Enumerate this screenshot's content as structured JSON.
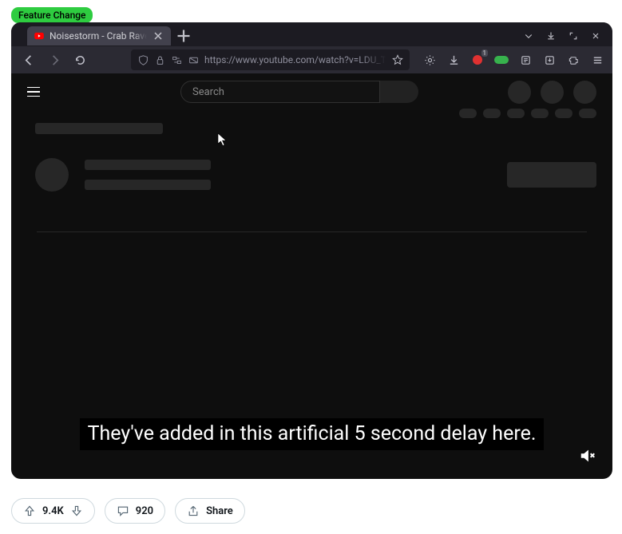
{
  "badge": {
    "label": "Feature Change"
  },
  "browser": {
    "tab": {
      "title": "Noisestorm - Crab Rave ["
    },
    "url": "https://www.youtube.com/watch?v=LDU_Txk",
    "notification_badge": "1"
  },
  "youtube": {
    "search_placeholder": "Search"
  },
  "caption": "They've added in this artificial 5 second delay here.",
  "actions": {
    "upvotes": "9.4K",
    "comments": "920",
    "share": "Share"
  }
}
